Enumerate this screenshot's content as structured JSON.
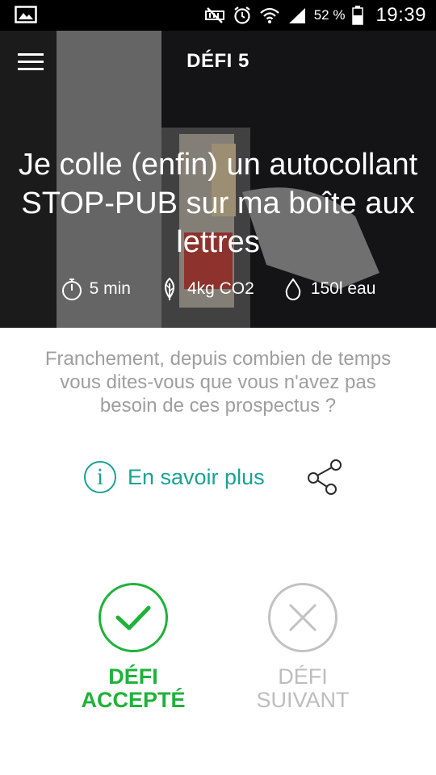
{
  "status_bar": {
    "battery_percent": "52 %",
    "time": "19:39",
    "icons": [
      "image-icon",
      "mute-icon",
      "alarm-icon",
      "wifi-icon",
      "signal-icon",
      "battery-icon"
    ]
  },
  "header": {
    "title": "DÉFI 5",
    "menu_icon": "hamburger-menu-icon"
  },
  "hero": {
    "headline": "Je colle (enfin) un autocollant STOP-PUB sur ma boîte aux lettres",
    "stats": [
      {
        "icon": "stopwatch-icon",
        "label": "5 min"
      },
      {
        "icon": "leaf-icon",
        "label": "4kg CO2"
      },
      {
        "icon": "water-drop-icon",
        "label": "150l eau"
      }
    ]
  },
  "description": "Franchement, depuis combien de temps vous dites-vous que vous n'avez pas besoin de ces prospectus ?",
  "info": {
    "label": "En savoir plus",
    "icon": "info-icon",
    "share_icon": "share-icon"
  },
  "actions": {
    "accept": {
      "line1": "DÉFI",
      "line2": "ACCEPTÉ",
      "icon": "checkmark-icon"
    },
    "next": {
      "line1": "DÉFI",
      "line2": "SUIVANT",
      "icon": "close-icon"
    }
  },
  "colors": {
    "accent_teal": "#1aa193",
    "accept_green": "#1fb23a",
    "muted_grey": "#bdbdbd",
    "text_grey": "#9e9e9e"
  }
}
